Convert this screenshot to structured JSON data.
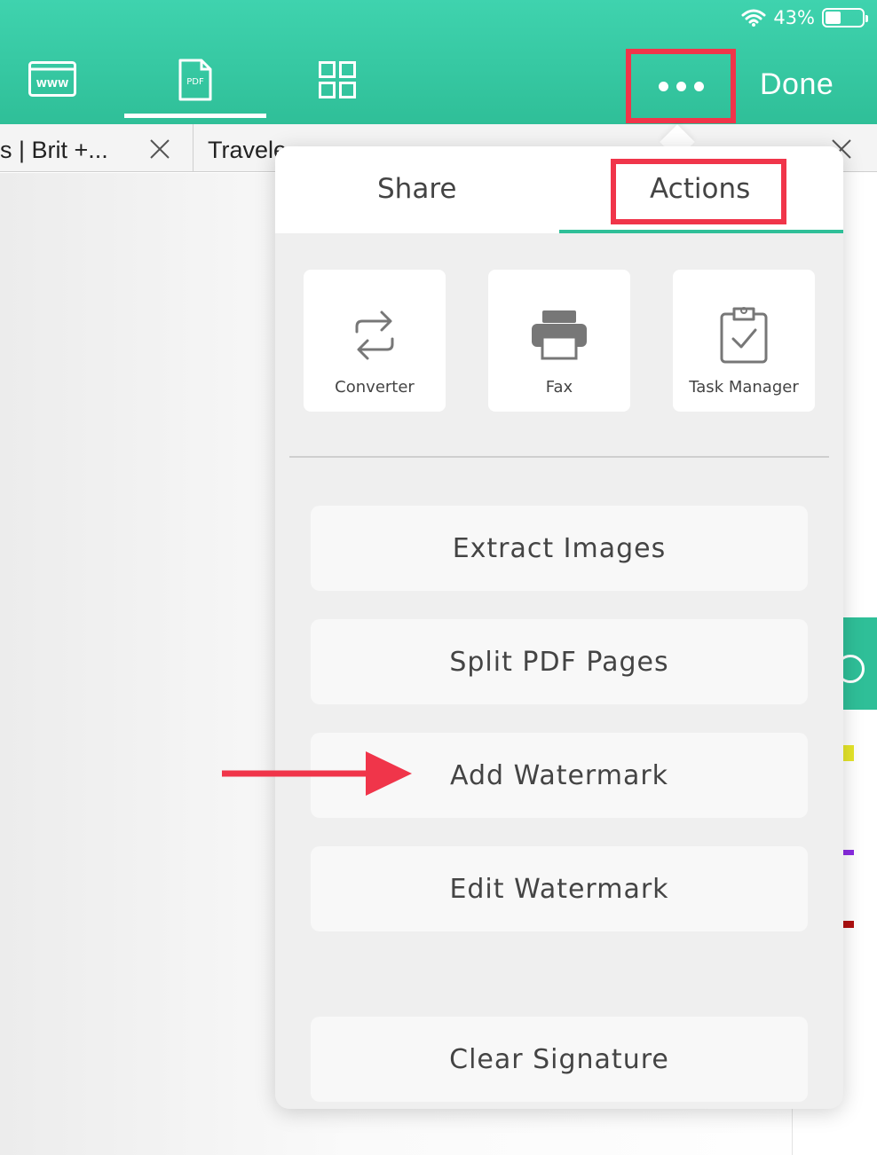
{
  "status_bar": {
    "battery_label": "43%",
    "battery_level": 0.43
  },
  "toolbar": {
    "web_icon_text": "WWW",
    "pdf_icon_text": "PDF",
    "done_label": "Done"
  },
  "tabs": [
    {
      "title": "s | Brit +..."
    },
    {
      "title": "Travele"
    }
  ],
  "popover": {
    "segments": {
      "share": "Share",
      "actions": "Actions"
    },
    "tiles": [
      {
        "label": "Converter",
        "icon": "converter-icon"
      },
      {
        "label": "Fax",
        "icon": "printer-icon"
      },
      {
        "label": "Task Manager",
        "icon": "clipboard-check-icon"
      }
    ],
    "actions": [
      "Extract Images",
      "Split PDF Pages",
      "Add Watermark",
      "Edit Watermark",
      "Clear Signature"
    ]
  },
  "colors": {
    "brand_green": "#2fbf98",
    "highlight_red": "#f0354a"
  }
}
